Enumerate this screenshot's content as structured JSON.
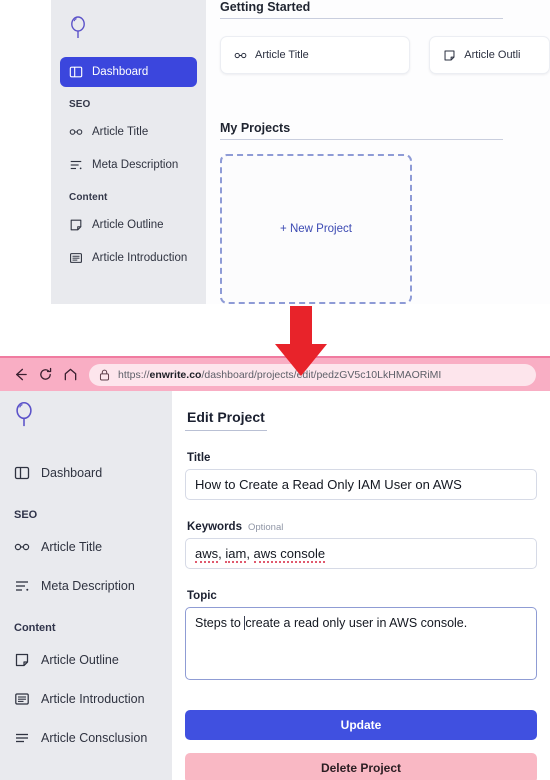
{
  "colors": {
    "accent": "#3b46dd",
    "update_button": "#4050e0",
    "delete_button": "#f9b8c4",
    "sidebar_bg": "#e9eaee",
    "browser_bar": "#f9aec4",
    "arrow": "#e8232a",
    "logo": "#5b52c9"
  },
  "top_screen": {
    "sidebar": {
      "logo_icon": "balloon-logo-icon",
      "items": [
        {
          "label": "Dashboard",
          "icon": "layout-panel-icon",
          "active": true
        }
      ],
      "groups": [
        {
          "label": "SEO",
          "items": [
            {
              "label": "Article Title",
              "icon": "glasses-icon"
            },
            {
              "label": "Meta Description",
              "icon": "text-lines-icon"
            }
          ]
        },
        {
          "label": "Content",
          "items": [
            {
              "label": "Article Outline",
              "icon": "sticky-note-icon"
            },
            {
              "label": "Article Introduction",
              "icon": "article-box-icon"
            }
          ]
        }
      ]
    },
    "main": {
      "getting_started_heading": "Getting Started",
      "cards": [
        {
          "label": "Article Title",
          "icon": "glasses-icon"
        },
        {
          "label": "Article Outli",
          "icon": "sticky-note-icon"
        }
      ],
      "my_projects_heading": "My Projects",
      "new_project_label": "+ New Project"
    }
  },
  "arrow": {
    "icon": "down-arrow-icon",
    "direction": "down"
  },
  "browser": {
    "back_icon": "back-arrow-icon",
    "reload_icon": "reload-icon",
    "home_icon": "home-icon",
    "lock_icon": "lock-icon",
    "url_scheme": "https://",
    "url_domain": "enwrite.co",
    "url_path": "/dashboard/projects/edit/pedzGV5c10LkHMAORiMI"
  },
  "bottom_screen": {
    "sidebar": {
      "logo_icon": "balloon-logo-icon",
      "items": [
        {
          "label": "Dashboard",
          "icon": "layout-panel-icon"
        }
      ],
      "groups": [
        {
          "label": "SEO",
          "items": [
            {
              "label": "Article Title",
              "icon": "glasses-icon"
            },
            {
              "label": "Meta Description",
              "icon": "text-lines-icon"
            }
          ]
        },
        {
          "label": "Content",
          "items": [
            {
              "label": "Article Outline",
              "icon": "sticky-note-icon"
            },
            {
              "label": "Article Introduction",
              "icon": "article-box-icon"
            },
            {
              "label": "Article Consclusion",
              "icon": "three-lines-icon"
            }
          ]
        }
      ]
    },
    "form": {
      "heading": "Edit Project",
      "title_label": "Title",
      "title_value": "How to Create a Read Only IAM User on AWS",
      "keywords_label": "Keywords",
      "keywords_optional": "Optional",
      "keywords_values": [
        "aws",
        "iam",
        "aws console"
      ],
      "keywords_value": "aws, iam, aws console",
      "topic_label": "Topic",
      "topic_value_before_caret": "Steps to ",
      "topic_value_after_caret": "create a read only user in AWS console.",
      "topic_value": "Steps to create a read only user in AWS console.",
      "update_label": "Update",
      "delete_label": "Delete Project"
    }
  }
}
